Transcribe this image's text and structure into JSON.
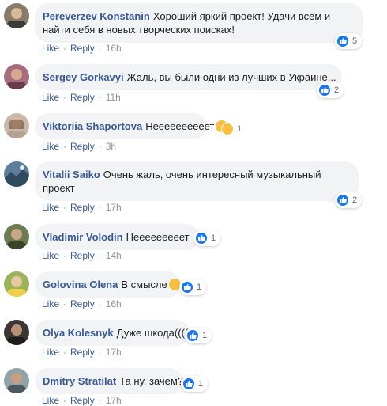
{
  "actions": {
    "like": "Like",
    "reply": "Reply"
  },
  "colors": {
    "link": "#385898",
    "bubble": "#f2f3f5",
    "like_blue": "#1877f2",
    "emoji_yellow": "#f7c043"
  },
  "comments": [
    {
      "author": "Pereverzev Konstanin",
      "text": "Хороший яркий проект! Удачи всем и найти себя в новых творческих поисках!",
      "time": "16h",
      "reactions": "5",
      "reaction_icons": [
        "like-icon"
      ]
    },
    {
      "author": "Sergey Gorkavyi",
      "text": "Жаль, вы были одни из лучших в Украине...",
      "time": "11h",
      "reactions": "2",
      "reaction_icons": [
        "like-icon"
      ]
    },
    {
      "author": "Viktoriia Shaportova",
      "text": "Неееееееееет",
      "time": "3h",
      "reactions": "1",
      "reaction_icons": [
        "sad-icon"
      ]
    },
    {
      "author": "Vitalii Saiko",
      "text": "Очень жаль, очень интересный музыкальный проект",
      "time": "17h",
      "reactions": "2",
      "reaction_icons": [
        "like-icon"
      ]
    },
    {
      "author": "Vladimir Volodin",
      "text": "Нееееееееет",
      "time": "14h",
      "reactions": "1",
      "reaction_icons": [
        "like-icon"
      ]
    },
    {
      "author": "Golovina Olena",
      "text": "В смысле",
      "time": "16h",
      "reactions": "1",
      "reaction_icons": [
        "like-icon"
      ]
    },
    {
      "author": "Olya Kolesnyk",
      "text": "Дуже шкода((((",
      "time": "17h",
      "reactions": "1",
      "reaction_icons": [
        "like-icon"
      ]
    },
    {
      "author": "Dmitry Stratilat",
      "text": "Та ну, зачем?",
      "time": "17h",
      "reactions": "1",
      "reaction_icons": [
        "like-icon"
      ]
    }
  ]
}
